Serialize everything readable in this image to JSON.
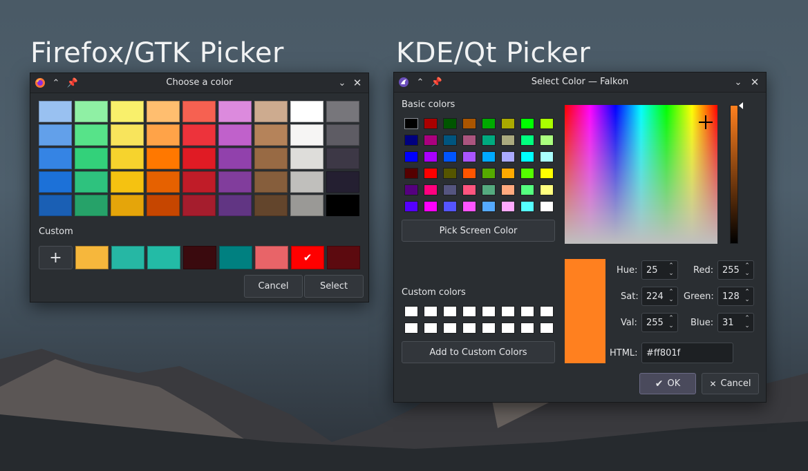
{
  "headings": {
    "left": "Firefox/GTK Picker",
    "right": "KDE/Qt Picker"
  },
  "gtk": {
    "title": "Choose a color",
    "palette": [
      [
        "#99c1f1",
        "#8ff0a4",
        "#f9f06b",
        "#ffbe6f",
        "#f66151",
        "#dc8add",
        "#cdab8f",
        "#ffffff",
        "#77767b"
      ],
      [
        "#62a0ea",
        "#57e389",
        "#f8e45c",
        "#ffa348",
        "#ed333b",
        "#c061cb",
        "#b5835a",
        "#f6f5f4",
        "#5e5c64"
      ],
      [
        "#3584e4",
        "#33d17a",
        "#f6d32d",
        "#ff7800",
        "#e01b24",
        "#9141ac",
        "#986a44",
        "#deddda",
        "#3d3846"
      ],
      [
        "#1c71d8",
        "#2ec27e",
        "#f5c211",
        "#e66100",
        "#c01c28",
        "#813d9c",
        "#865e3c",
        "#c0bfbc",
        "#241f31"
      ],
      [
        "#1a5fb4",
        "#26a269",
        "#e5a50a",
        "#c64600",
        "#a51d2d",
        "#613583",
        "#63452c",
        "#9a9996",
        "#000000"
      ]
    ],
    "custom_label": "Custom",
    "custom_colors": [
      "#f6b73c",
      "#26b7a4",
      "#23bba6",
      "#3a0a0e",
      "#008080",
      "#e86468",
      "#ff0000",
      "#5c0a0f"
    ],
    "cancel_label": "Cancel",
    "select_label": "Select"
  },
  "qt": {
    "title": "Select Color — Falkon",
    "basic_colors_label": "Basic colors",
    "basic_colors": [
      [
        "#000000",
        "#aa0000",
        "#005500",
        "#aa5500",
        "#00aa00",
        "#aaaa00",
        "#00ff00",
        "#aaff00"
      ],
      [
        "#00007f",
        "#aa007f",
        "#00557f",
        "#aa557f",
        "#00aa7f",
        "#aaaa7f",
        "#00ff7f",
        "#aaff7f"
      ],
      [
        "#0000ff",
        "#aa00ff",
        "#0055ff",
        "#aa55ff",
        "#00aaff",
        "#aaaaff",
        "#00ffff",
        "#aaffff"
      ],
      [
        "#550000",
        "#ff0000",
        "#555500",
        "#ff5500",
        "#55aa00",
        "#ffaa00",
        "#55ff00",
        "#ffff00"
      ],
      [
        "#55007f",
        "#ff007f",
        "#55557f",
        "#ff557f",
        "#55aa7f",
        "#ffaa7f",
        "#55ff7f",
        "#ffff7f"
      ],
      [
        "#5500ff",
        "#ff00ff",
        "#5555ff",
        "#ff55ff",
        "#55aaff",
        "#ffaaff",
        "#55ffff",
        "#ffffff"
      ]
    ],
    "pick_screen_label": "Pick Screen Color",
    "custom_colors_label": "Custom colors",
    "custom_colors_count": 16,
    "add_custom_label": "Add to Custom Colors",
    "current_color": "#ff801f",
    "hue_label": "Hue:",
    "hue": "25",
    "sat_label": "Sat:",
    "sat": "224",
    "val_label": "Val:",
    "val": "255",
    "red_label": "Red:",
    "red": "255",
    "green_label": "Green:",
    "green": "128",
    "blue_label": "Blue:",
    "blue": "31",
    "html_label": "HTML:",
    "html": "#ff801f",
    "ok_label": "OK",
    "cancel_label": "Cancel"
  }
}
